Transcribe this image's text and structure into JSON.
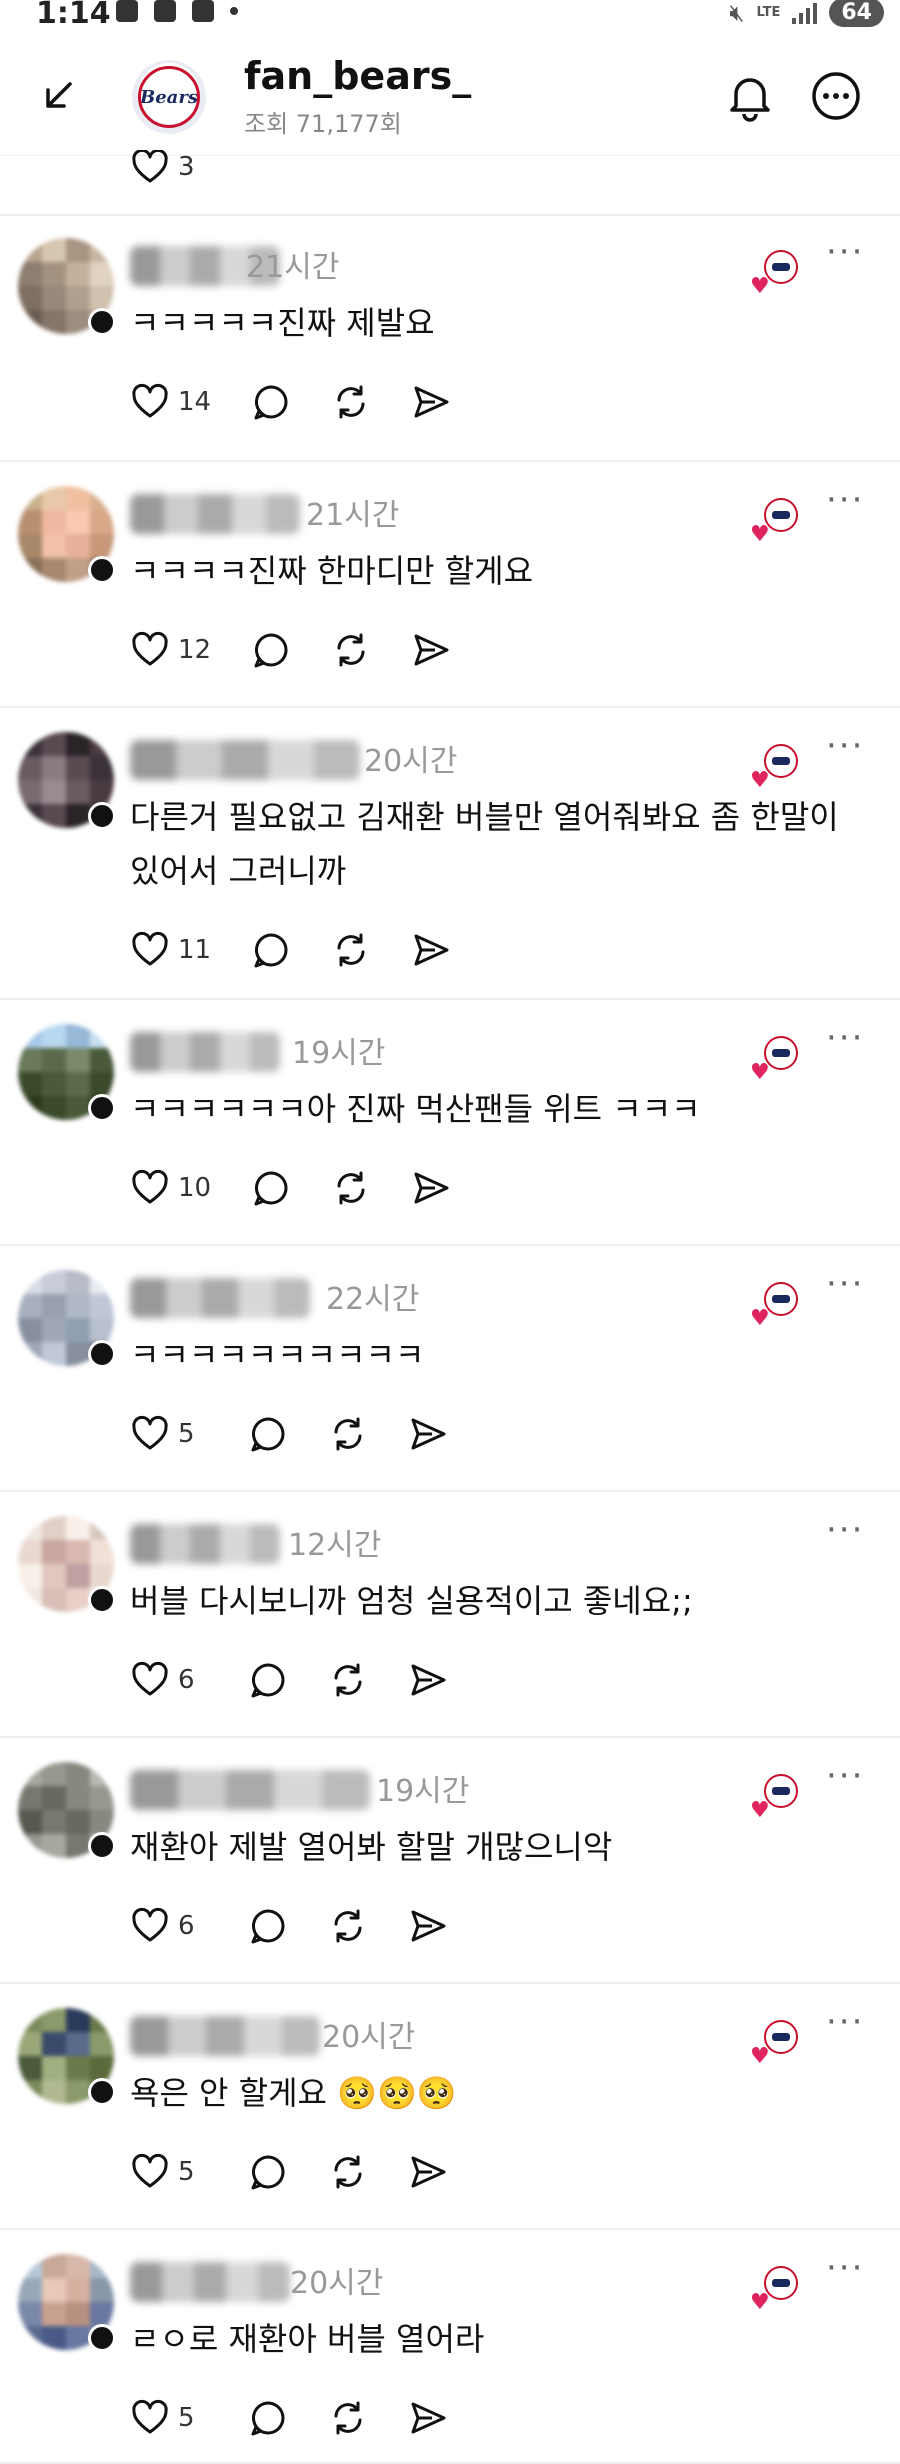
{
  "status_bar": {
    "time": "1:14",
    "network": "LTE",
    "battery": "64"
  },
  "header": {
    "username": "fan_bears_",
    "views": "조회 71,177회",
    "logo_text": "Bears"
  },
  "top_row": {
    "like_count": "3"
  },
  "comments": [
    {
      "time": "21시간",
      "text": "ㅋㅋㅋㅋㅋ진짜 제발요",
      "likes": "14"
    },
    {
      "time": "21시간",
      "text": "ㅋㅋㅋㅋ진짜 한마디만 할게요",
      "likes": "12"
    },
    {
      "time": "20시간",
      "text": "다른거 필요없고 김재환 버블만 열어줘봐요 좀 한말이 있어서 그러니까",
      "likes": "11"
    },
    {
      "time": "19시간",
      "text": "ㅋㅋㅋㅋㅋㅋ아 진짜 먹산팬들 위트 ㅋㅋㅋ",
      "likes": "10"
    },
    {
      "time": "22시간",
      "text": "ㅋㅋㅋㅋㅋㅋㅋㅋㅋㅋ",
      "likes": "5"
    },
    {
      "time": "12시간",
      "text": "버블 다시보니까 엄청 실용적이고 좋네요;;",
      "likes": "6"
    },
    {
      "time": "19시간",
      "text": "재환아 제발 열어봐 할말 개많으니악",
      "likes": "6"
    },
    {
      "time": "20시간",
      "text": "욕은 안 할게요 🥺🥺🥺",
      "likes": "5"
    },
    {
      "time": "20시간",
      "text": "ㄹㅇ로 재환아 버블 열어라",
      "likes": "5"
    }
  ],
  "icons": {
    "like": "heart-icon",
    "reply": "comment-icon",
    "repost": "repost-icon",
    "share": "send-icon",
    "more": "more-dots-icon"
  },
  "colors": {
    "heart": "#e0245e",
    "brand_navy": "#1a2a5e",
    "brand_red": "#c8102e"
  }
}
